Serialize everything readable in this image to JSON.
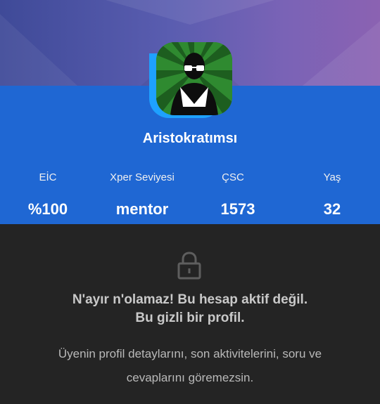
{
  "profile": {
    "username": "Aristokratımsı",
    "avatar_icon": "masked-figure-avatar-icon"
  },
  "stats": [
    {
      "label": "EİC",
      "value": "%100"
    },
    {
      "label": "Xper Seviyesi",
      "value": "mentor"
    },
    {
      "label": "ÇSC",
      "value": "1573"
    },
    {
      "label": "Yaş",
      "value": "32"
    }
  ],
  "private_notice": {
    "icon": "lock-icon",
    "title_line1": "N'ayır n'olamaz! Bu hesap aktif değil.",
    "title_line2": "Bu gizli bir profil.",
    "body": "Üyenin profil detaylarını, son aktivitelerini, soru ve cevaplarını göremezsin."
  },
  "colors": {
    "header_gradient_start": "#3f4a98",
    "header_gradient_end": "#8b62b2",
    "band_blue": "#1f67d3",
    "avatar_ring": "#1ea1ff",
    "dark_background": "#242424"
  }
}
